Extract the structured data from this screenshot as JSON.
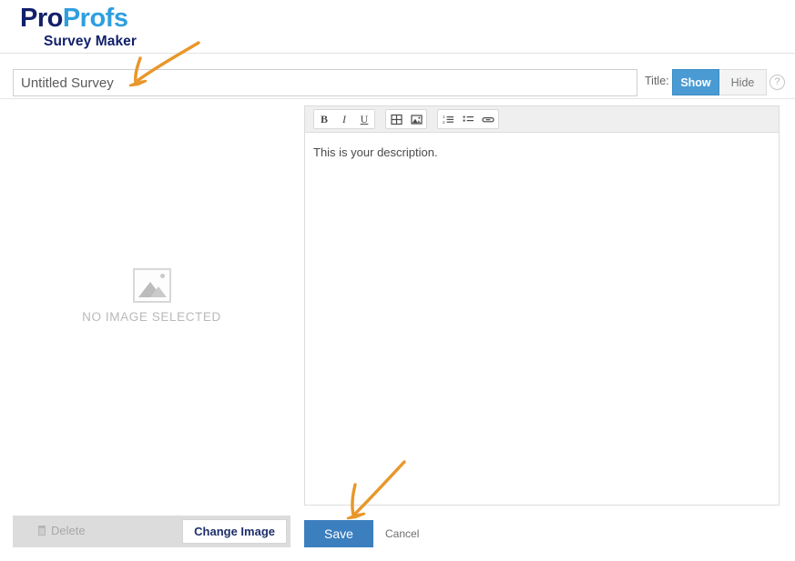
{
  "header": {
    "logo_pro": "Pro",
    "logo_profs": "Profs",
    "logo_subtitle": "Survey Maker"
  },
  "title_row": {
    "survey_title_value": "Untitled Survey",
    "survey_title_placeholder": "Untitled Survey",
    "title_label": "Title:",
    "show_label": "Show",
    "hide_label": "Hide",
    "help_icon": "question-mark-icon",
    "active_segment": "Show",
    "accent_color": "#4a9bd4"
  },
  "image_panel": {
    "placeholder_text": "NO IMAGE SELECTED",
    "placeholder_icon": "image-placeholder-icon",
    "delete_label": "Delete",
    "delete_icon": "trash-icon",
    "delete_disabled": true,
    "change_image_label": "Change Image"
  },
  "editor": {
    "toolbar": [
      {
        "group": 1,
        "items": [
          {
            "name": "bold-icon",
            "label": "B"
          },
          {
            "name": "italic-icon",
            "label": "I"
          },
          {
            "name": "underline-icon",
            "label": "U"
          }
        ]
      },
      {
        "group": 2,
        "items": [
          {
            "name": "table-icon",
            "label": ""
          },
          {
            "name": "image-icon",
            "label": ""
          }
        ]
      },
      {
        "group": 3,
        "items": [
          {
            "name": "ordered-list-icon",
            "label": ""
          },
          {
            "name": "unordered-list-icon",
            "label": ""
          },
          {
            "name": "link-icon",
            "label": ""
          }
        ]
      }
    ],
    "body_text": "This is your description."
  },
  "actions": {
    "save_label": "Save",
    "cancel_label": "Cancel",
    "save_color": "#3b7fbe"
  },
  "annotations": {
    "arrow_color": "#e8972a",
    "arrows": [
      {
        "name": "arrow-pointing-to-title-input",
        "target": "survey-title-input"
      },
      {
        "name": "arrow-pointing-to-save-button",
        "target": "save-button"
      }
    ]
  }
}
